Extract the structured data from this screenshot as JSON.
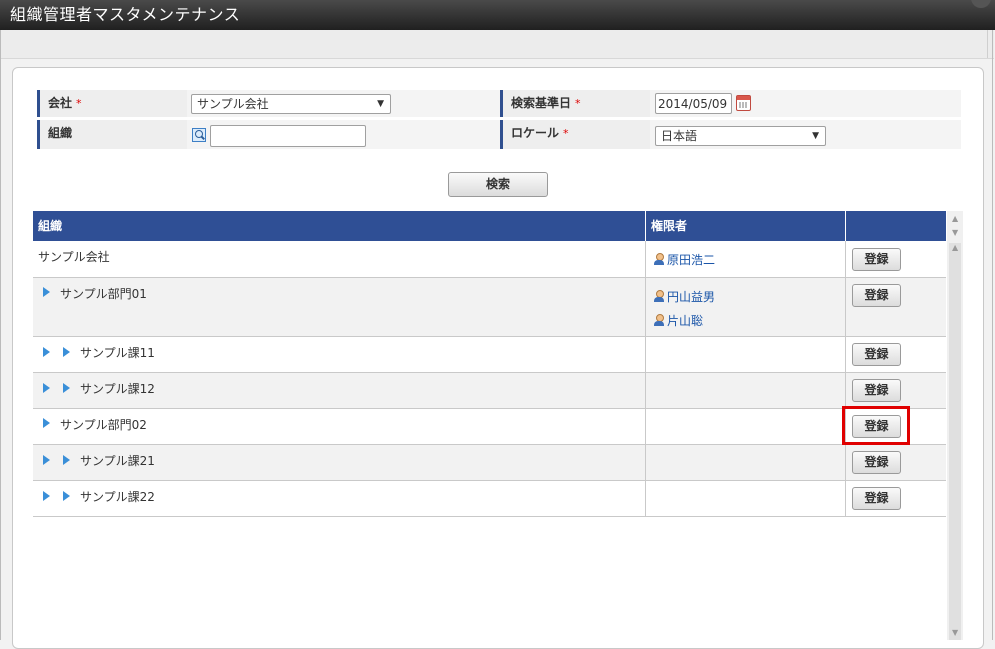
{
  "window": {
    "title": "組織管理者マスタメンテナンス"
  },
  "search_form": {
    "company_label": "会社",
    "company_value": "サンプル会社",
    "date_label": "検索基準日",
    "date_value": "2014/05/09",
    "organization_label": "組織",
    "organization_value": "",
    "locale_label": "ロケール",
    "locale_value": "日本語",
    "required_mark": "*",
    "search_button": "検索"
  },
  "table": {
    "headers": [
      "組織",
      "権限者",
      ""
    ],
    "register_label": "登録",
    "rows": [
      {
        "organization": "サンプル会社",
        "depth": 0,
        "admins": [
          "原田浩二"
        ]
      },
      {
        "organization": "サンプル部門01",
        "depth": 1,
        "admins": [
          "円山益男",
          "片山聡"
        ]
      },
      {
        "organization": "サンプル課11",
        "depth": 2,
        "admins": []
      },
      {
        "organization": "サンプル課12",
        "depth": 2,
        "admins": []
      },
      {
        "organization": "サンプル部門02",
        "depth": 1,
        "admins": [],
        "highlighted": true
      },
      {
        "organization": "サンプル課21",
        "depth": 2,
        "admins": []
      },
      {
        "organization": "サンプル課22",
        "depth": 2,
        "admins": []
      }
    ]
  },
  "colors": {
    "header_bg": "#2f4f95",
    "title_bar": "#2a2a2a",
    "highlight": "#e00000",
    "link": "#1a55a8"
  }
}
